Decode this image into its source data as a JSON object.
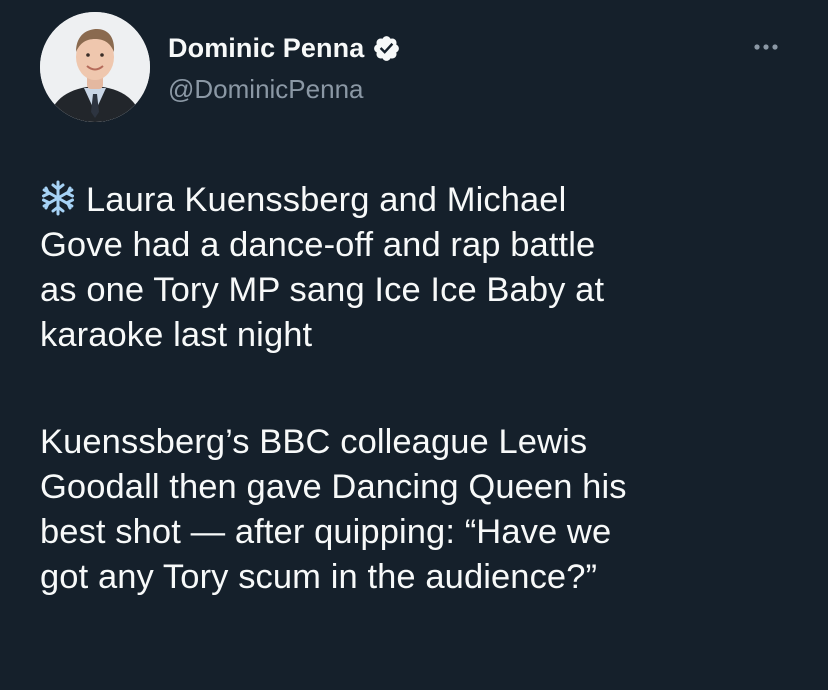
{
  "author": {
    "display_name": "Dominic Penna",
    "handle": "@DominicPenna",
    "avatar_icon": "profile-photo",
    "verified_icon": "verified-badge-icon",
    "verified_color": "#1d9bf0"
  },
  "menu": {
    "more_icon": "more-horizontal-icon"
  },
  "tweet": {
    "emoji_icon": "snowflake-icon",
    "paragraph1": {
      "lines": [
        "Laura Kuenssberg and Michael",
        "Gove had a dance-off and rap battle",
        "as one Tory MP sang Ice Ice Baby at",
        "karaoke last night"
      ]
    },
    "paragraph2": {
      "lines": [
        "Kuenssberg’s BBC colleague Lewis",
        "Goodall then gave Dancing Queen his",
        "best shot — after quipping: “Have we",
        "got any Tory scum in the audience?”"
      ]
    }
  },
  "colors": {
    "background": "#15202b",
    "text": "#f7f9f9",
    "secondary_text": "#8b98a5"
  }
}
